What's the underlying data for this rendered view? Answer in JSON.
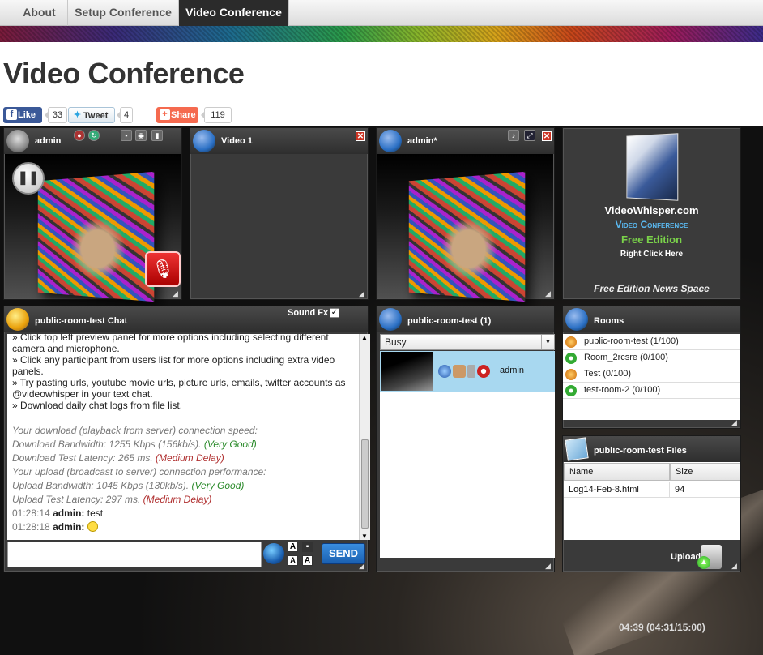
{
  "nav": {
    "tabs": [
      "About",
      "Setup Conference",
      "Video Conference"
    ]
  },
  "page": {
    "title": "Video Conference"
  },
  "social": {
    "like_label": "Like",
    "like_count": "33",
    "tweet_label": "Tweet",
    "tweet_count": "4",
    "share_label": "Share",
    "share_count": "119"
  },
  "local_video": {
    "name": "admin"
  },
  "video1": {
    "title": "Video 1"
  },
  "remote_video": {
    "name": "admin*"
  },
  "ad": {
    "line1": "VideoWhisper.com",
    "line2": "Video Conference",
    "line3": "Free Edition",
    "line4": "Right Click Here",
    "footer": "Free Edition News Space"
  },
  "chat": {
    "title": "public-room-test Chat",
    "sound_fx_label": "Sound Fx",
    "messages": [
      "» Click top left preview panel for more options including selecting different camera and microphone.",
      "» Click any participant from users list for more options including extra video panels.",
      "» Try pasting urls, youtube movie urls, picture urls, emails, twitter accounts as @videowhisper in your text chat.",
      "» Download daily chat logs from file list."
    ],
    "stats": {
      "download_head": "Your download (playback from server) connection speed:",
      "download_bw": "Download Bandwidth: 1255 Kbps (156kb/s).",
      "download_bw_rating": "(Very Good)",
      "download_lat": "Download Test Latency: 265 ms.",
      "download_lat_rating": "(Medium Delay)",
      "upload_head": "Your upload (broadcast to server) connection performance:",
      "upload_bw": "Upload Bandwidth: 1045 Kbps (130kb/s).",
      "upload_bw_rating": "(Very Good)",
      "upload_lat": "Upload Test Latency: 297 ms.",
      "upload_lat_rating": "(Medium Delay)"
    },
    "log": [
      {
        "time": "01:28:14",
        "user": "admin:",
        "text": " test"
      },
      {
        "time": "01:28:18",
        "user": "admin:",
        "text": " "
      }
    ],
    "send_label": "SEND"
  },
  "users": {
    "title": "public-room-test (1)",
    "status": "Busy",
    "list": [
      {
        "name": "admin"
      }
    ]
  },
  "rooms": {
    "title": "Rooms",
    "items": [
      {
        "label": "public-room-test (1/100)",
        "icon": "users-icon"
      },
      {
        "label": "Room_2rcsre (0/100)",
        "icon": "key-icon"
      },
      {
        "label": "Test (0/100)",
        "icon": "users-icon"
      },
      {
        "label": "test-room-2 (0/100)",
        "icon": "key-icon"
      }
    ]
  },
  "files": {
    "title": "public-room-test Files",
    "columns": [
      "Name",
      "Size"
    ],
    "rows": [
      {
        "name": "Log14-Feb-8.html",
        "size": "94"
      }
    ],
    "upload_label": "Upload"
  },
  "timer": "04:39 (04:31/15:00)"
}
